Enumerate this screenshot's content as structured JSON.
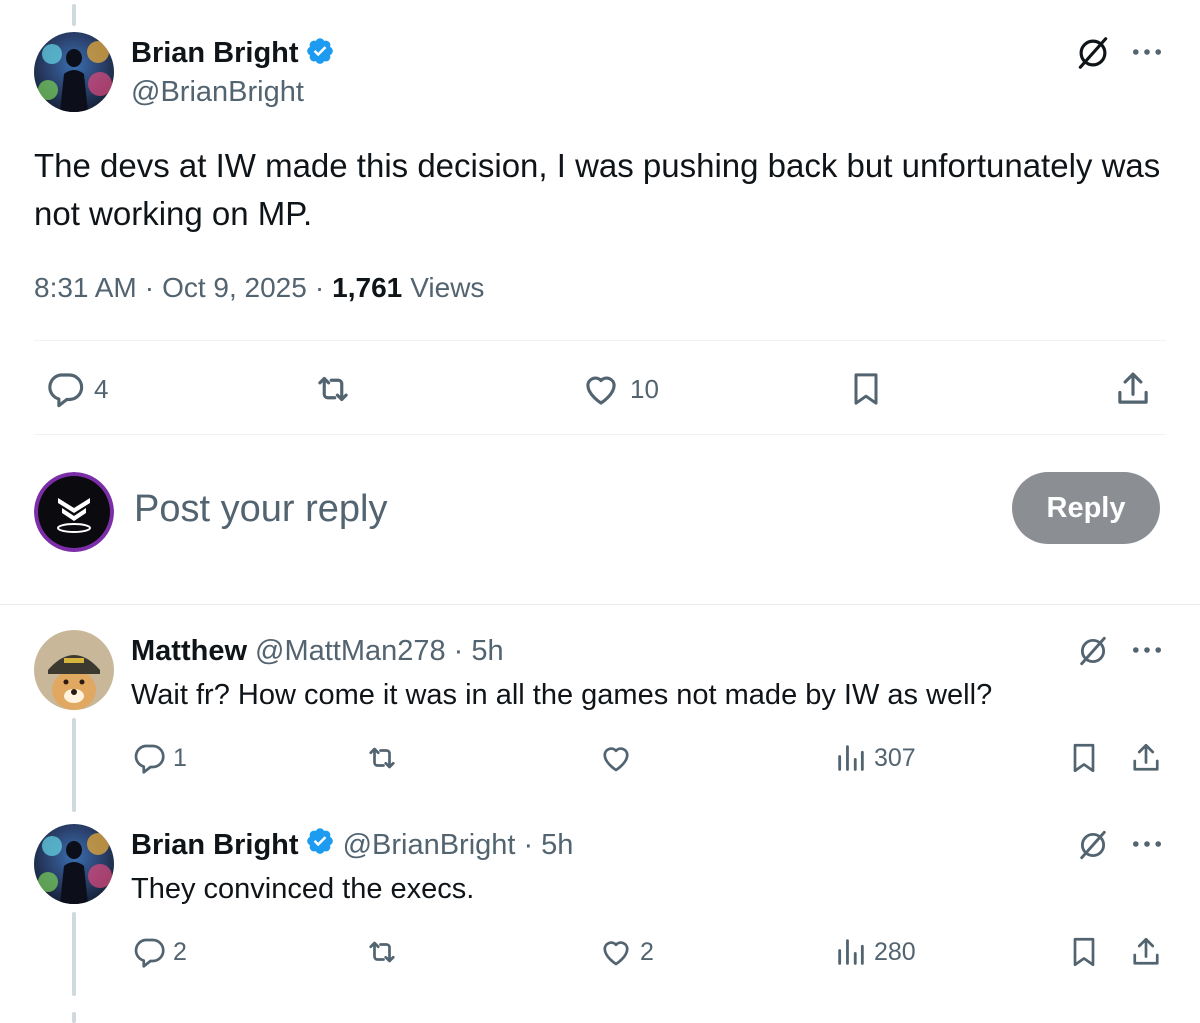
{
  "main_post": {
    "author_name": "Brian Bright",
    "author_handle": "@BrianBright",
    "text": "The devs at IW made this decision, I was pushing back but unfortunately was not working on MP.",
    "time": "8:31 AM",
    "date": "Oct 9, 2025",
    "views_count": "1,761",
    "views_label": "Views",
    "reply_count": "4",
    "like_count": "10"
  },
  "composer": {
    "placeholder": "Post your reply",
    "button_label": "Reply"
  },
  "replies": [
    {
      "author_name": "Matthew",
      "author_handle": "@MattMan278",
      "separator": "·",
      "time": "5h",
      "text": "Wait fr? How come it was in all the games not made by IW as well?",
      "reply_count": "1",
      "like_count": "",
      "views_count": "307"
    },
    {
      "author_name": "Brian Bright",
      "author_handle": "@BrianBright",
      "separator": "·",
      "time": "5h",
      "text": "They convinced the execs.",
      "reply_count": "2",
      "like_count": "2",
      "views_count": "280"
    }
  ],
  "colors": {
    "verified": "#1d9bf0",
    "text": "#0f1419",
    "muted": "#536471",
    "reply_button": "#8b8f93"
  },
  "icons": [
    "verified-badge-icon",
    "grok-icon",
    "more-icon",
    "reply-icon",
    "retweet-icon",
    "like-icon",
    "bookmark-icon",
    "share-icon",
    "views-icon"
  ]
}
